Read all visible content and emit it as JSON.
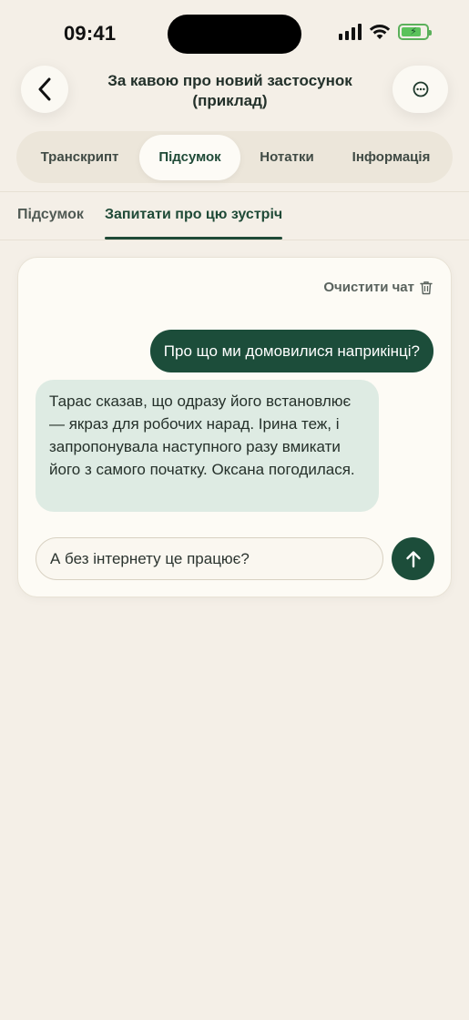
{
  "status_bar": {
    "time": "09:41"
  },
  "header": {
    "back_icon": "chevron-left-icon",
    "title": "За кавою про новий застосунок (приклад)",
    "more_icon": "ellipsis-circle-icon"
  },
  "tabs": [
    {
      "label": "Транскрипт",
      "active": false
    },
    {
      "label": "Підсумок",
      "active": true
    },
    {
      "label": "Нотатки",
      "active": false
    },
    {
      "label": "Інформація",
      "active": false
    }
  ],
  "subtabs": [
    {
      "label": "Підсумок",
      "active": false
    },
    {
      "label": "Запитати про цю зустріч",
      "active": true
    }
  ],
  "chat": {
    "clear_label": "Очистити чат",
    "clear_icon": "trash-icon",
    "messages": [
      {
        "role": "user",
        "text": "Про що ми домовилися наприкінці?"
      },
      {
        "role": "assistant",
        "text": "Тарас сказав, що одразу його встановлює — якраз для робочих нарад. Ірина теж, і запропонувала наступного разу вмикати його з самого початку. Оксана погодилася."
      }
    ],
    "input_value": "А без інтернету це працює?",
    "send_icon": "arrow-up-icon"
  },
  "colors": {
    "background": "#f4efe7",
    "accent": "#1c4d3a",
    "assistant_bubble": "#deebe3",
    "battery": "#5bc25b"
  }
}
